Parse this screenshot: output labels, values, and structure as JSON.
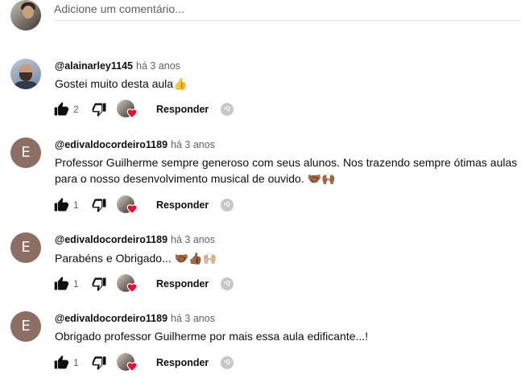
{
  "add_comment": {
    "placeholder": "Adicione um comentário..."
  },
  "comments": [
    {
      "author": "@alainarley1145",
      "time": "há 3 anos",
      "text": "Gostei muito desta aula👍",
      "likes": "2",
      "reply_label": "Responder",
      "avatar": "photo"
    },
    {
      "author": "@edivaldocordeiro1189",
      "time": "há 3 anos",
      "text": "Professor Guilherme sempre generoso com seus alunos. Nos trazendo sempre ótimas aulas para o nosso desenvolvimento musical de ouvido. 🤝🏾🙌🏾",
      "likes": "1",
      "reply_label": "Responder",
      "avatar": "E"
    },
    {
      "author": "@edivaldocordeiro1189",
      "time": "há 3 anos",
      "text": "Parabéns e Obrigado... 🤝🏾👍🏾🙌🏼",
      "likes": "1",
      "reply_label": "Responder",
      "avatar": "E"
    },
    {
      "author": "@edivaldocordeiro1189",
      "time": "há 3 anos",
      "text": "Obrigado professor Guilherme por mais essa aula edificante...!",
      "likes": "1",
      "reply_label": "Responder",
      "avatar": "E"
    }
  ],
  "icons": {
    "like": "thumbs-up-icon",
    "dislike": "thumbs-down-icon",
    "creator_heart": "creator-heart-icon",
    "replies": "replies-count-icon"
  },
  "colors": {
    "letter_avatar": "#8d6e63",
    "heart": "#ff0033"
  }
}
